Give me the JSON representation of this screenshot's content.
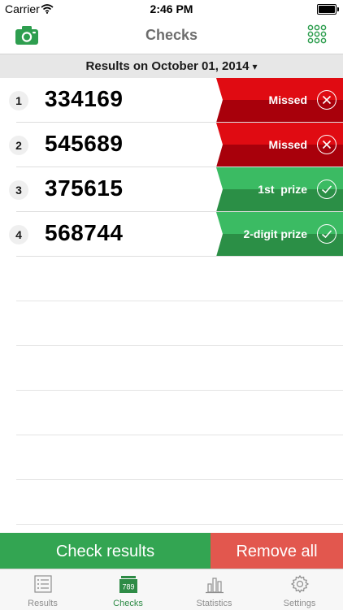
{
  "status_bar": {
    "carrier": "Carrier",
    "time": "2:46 PM"
  },
  "nav": {
    "title": "Checks",
    "left_icon": "camera-icon",
    "right_icon": "grid-icon"
  },
  "date_header": {
    "label": "Results on October 01, 2014",
    "caret": "▾"
  },
  "colors": {
    "accent_green": "#33a552",
    "missed_red": "#e00b12",
    "missed_dark": "#a8000b",
    "prize_green": "#3bbb63",
    "prize_dark": "#2b8f46",
    "remove_red": "#e2574e"
  },
  "rows": [
    {
      "index": "1",
      "number": "334169",
      "result": "Missed",
      "status": "missed",
      "icon": "close-circle-icon"
    },
    {
      "index": "2",
      "number": "545689",
      "result": "Missed",
      "status": "missed",
      "icon": "close-circle-icon"
    },
    {
      "index": "3",
      "number": "375615",
      "result": "1st  prize",
      "status": "prize",
      "icon": "check-circle-icon"
    },
    {
      "index": "4",
      "number": "568744",
      "result": "2-digit prize",
      "status": "prize",
      "icon": "check-circle-icon"
    }
  ],
  "actions": {
    "check": "Check results",
    "remove": "Remove all"
  },
  "tabs": [
    {
      "label": "Results",
      "icon": "list-icon",
      "active": false
    },
    {
      "label": "Checks",
      "icon": "ticket-icon",
      "icon_text": "789",
      "active": true
    },
    {
      "label": "Statistics",
      "icon": "bar-chart-icon",
      "active": false
    },
    {
      "label": "Settings",
      "icon": "gear-icon",
      "active": false
    }
  ]
}
